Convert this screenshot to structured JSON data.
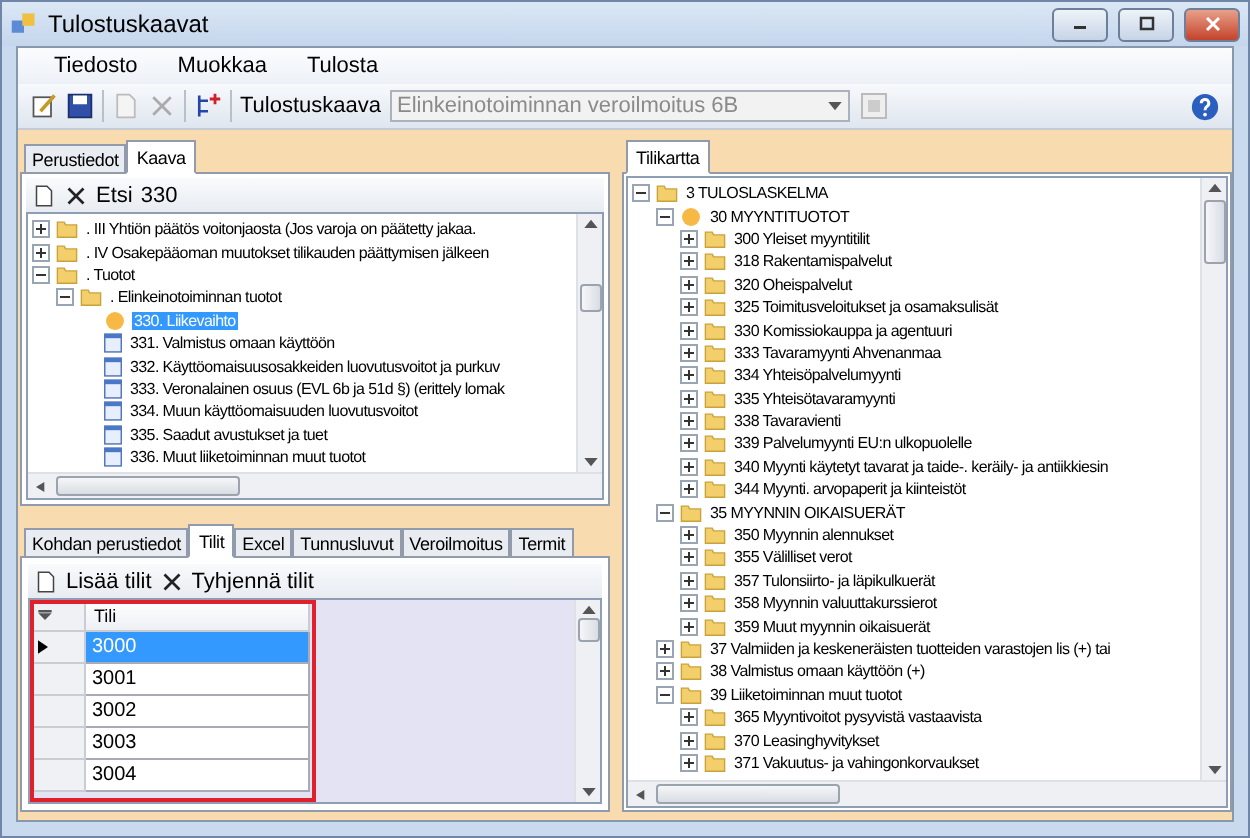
{
  "window": {
    "title": "Tulostuskaavat"
  },
  "menu": [
    "Tiedosto",
    "Muokkaa",
    "Tulosta"
  ],
  "toolbar": {
    "label": "Tulostuskaava",
    "combo_value": "Elinkeinotoiminnan veroilmoitus 6B",
    "combo_disabled": true
  },
  "top_tabs": [
    {
      "label": "Perustiedot",
      "selected": false
    },
    {
      "label": "Kaava",
      "selected": true
    }
  ],
  "formula_toolbar": {
    "search_label": "Etsi",
    "search_value": "330"
  },
  "formula_tree": [
    {
      "label": ". III Yhtiön päätös voitonjaosta (Jos varoja on päätetty jakaa.",
      "kind": "folder",
      "expanded": false,
      "selected": false
    },
    {
      "label": ". IV Osakepääoman muutokset tilikauden päättymisen jälkeen",
      "kind": "folder",
      "expanded": false,
      "selected": false
    },
    {
      "label": ". Tuotot",
      "kind": "folder",
      "expanded": true,
      "selected": false,
      "children": [
        {
          "label": ". Elinkeinotoiminnan tuotot",
          "kind": "folder",
          "expanded": true,
          "selected": false,
          "children": [
            {
              "label": "330. Liikevaihto",
              "kind": "bullet",
              "selected": true
            },
            {
              "label": "331. Valmistus omaan käyttöön",
              "kind": "doc",
              "selected": false
            },
            {
              "label": "332. Käyttöomaisuusosakkeiden luovutusvoitot ja purkuv",
              "kind": "doc",
              "selected": false
            },
            {
              "label": "333. Veronalainen osuus (EVL 6b ja 51d §) (erittely lomak",
              "kind": "doc",
              "selected": false
            },
            {
              "label": "334. Muun käyttöomaisuuden luovutusvoitot",
              "kind": "doc",
              "selected": false
            },
            {
              "label": "335. Saadut avustukset ja tuet",
              "kind": "doc",
              "selected": false
            },
            {
              "label": "336. Muut liiketoiminnan muut tuotot",
              "kind": "doc",
              "selected": false
            }
          ]
        }
      ]
    }
  ],
  "bottom_tabs": [
    {
      "label": "Kohdan perustiedot",
      "selected": false
    },
    {
      "label": "Tilit",
      "selected": true
    },
    {
      "label": "Excel",
      "selected": false
    },
    {
      "label": "Tunnusluvut",
      "selected": false
    },
    {
      "label": "Veroilmoitus",
      "selected": false
    },
    {
      "label": "Termit",
      "selected": false
    }
  ],
  "accounts_toolbar": [
    "Lisää tilit",
    "Tyhjennä tilit"
  ],
  "accounts_grid": {
    "column": "Tili",
    "rows": [
      {
        "value": "3000",
        "selected": true
      },
      {
        "value": "3001",
        "selected": false
      },
      {
        "value": "3002",
        "selected": false
      },
      {
        "value": "3003",
        "selected": false
      },
      {
        "value": "3004",
        "selected": false
      }
    ]
  },
  "right_tabs": [
    {
      "label": "Tilikartta",
      "selected": true
    }
  ],
  "account_tree": [
    {
      "label": "3 TULOSLASKELMA",
      "kind": "folder",
      "expanded": true,
      "selected": false,
      "children": [
        {
          "label": "30 MYYNTITUOTOT",
          "kind": "bullet",
          "expanded": true,
          "selected": false,
          "children": [
            {
              "label": "300 Yleiset myyntitilit",
              "kind": "folder",
              "expanded": false,
              "selected": false
            },
            {
              "label": "318 Rakentamispalvelut",
              "kind": "folder",
              "expanded": false,
              "selected": false
            },
            {
              "label": "320 Oheispalvelut",
              "kind": "folder",
              "expanded": false,
              "selected": false
            },
            {
              "label": "325 Toimitusveloitukset ja osamaksulisät",
              "kind": "folder",
              "expanded": false,
              "selected": false
            },
            {
              "label": "330 Komissiokauppa ja agentuuri",
              "kind": "folder",
              "expanded": false,
              "selected": false
            },
            {
              "label": "333 Tavaramyynti Ahvenanmaa",
              "kind": "folder",
              "expanded": false,
              "selected": false
            },
            {
              "label": "334 Yhteisöpalvelumyynti",
              "kind": "folder",
              "expanded": false,
              "selected": false
            },
            {
              "label": "335 Yhteisötavaramyynti",
              "kind": "folder",
              "expanded": false,
              "selected": false
            },
            {
              "label": "338 Tavaravienti",
              "kind": "folder",
              "expanded": false,
              "selected": false
            },
            {
              "label": "339 Palvelumyynti EU:n ulkopuolelle",
              "kind": "folder",
              "expanded": false,
              "selected": false
            },
            {
              "label": "340 Myynti käytetyt tavarat ja taide-. keräily- ja antiikkiesin",
              "kind": "folder",
              "expanded": false,
              "selected": false
            },
            {
              "label": "344 Myynti. arvopaperit ja kiinteistöt",
              "kind": "folder",
              "expanded": false,
              "selected": false
            }
          ]
        },
        {
          "label": "35 MYYNNIN OIKAISUERÄT",
          "kind": "folder",
          "expanded": true,
          "selected": false,
          "children": [
            {
              "label": "350 Myynnin alennukset",
              "kind": "folder",
              "expanded": false,
              "selected": false
            },
            {
              "label": "355 Välilliset verot",
              "kind": "folder",
              "expanded": false,
              "selected": false
            },
            {
              "label": "357 Tulonsiirto- ja läpikulkuerät",
              "kind": "folder",
              "expanded": false,
              "selected": false
            },
            {
              "label": "358 Myynnin valuuttakurssierot",
              "kind": "folder",
              "expanded": false,
              "selected": false
            },
            {
              "label": "359 Muut myynnin oikaisuerät",
              "kind": "folder",
              "expanded": false,
              "selected": false
            }
          ]
        },
        {
          "label": "37 Valmiiden ja keskeneräisten tuotteiden varastojen lis (+) tai",
          "kind": "folder",
          "expanded": false,
          "selected": false
        },
        {
          "label": "38 Valmistus omaan käyttöön (+)",
          "kind": "folder",
          "expanded": false,
          "selected": false
        },
        {
          "label": "39 Liiketoiminnan muut tuotot",
          "kind": "folder",
          "expanded": true,
          "selected": false,
          "children": [
            {
              "label": "365 Myyntivoitot pysyvistä vastaavista",
              "kind": "folder",
              "expanded": false,
              "selected": false
            },
            {
              "label": "370 Leasinghyvitykset",
              "kind": "folder",
              "expanded": false,
              "selected": false
            },
            {
              "label": "371 Vakuutus- ja vahingonkorvaukset",
              "kind": "folder",
              "expanded": false,
              "selected": false
            }
          ]
        }
      ]
    }
  ]
}
